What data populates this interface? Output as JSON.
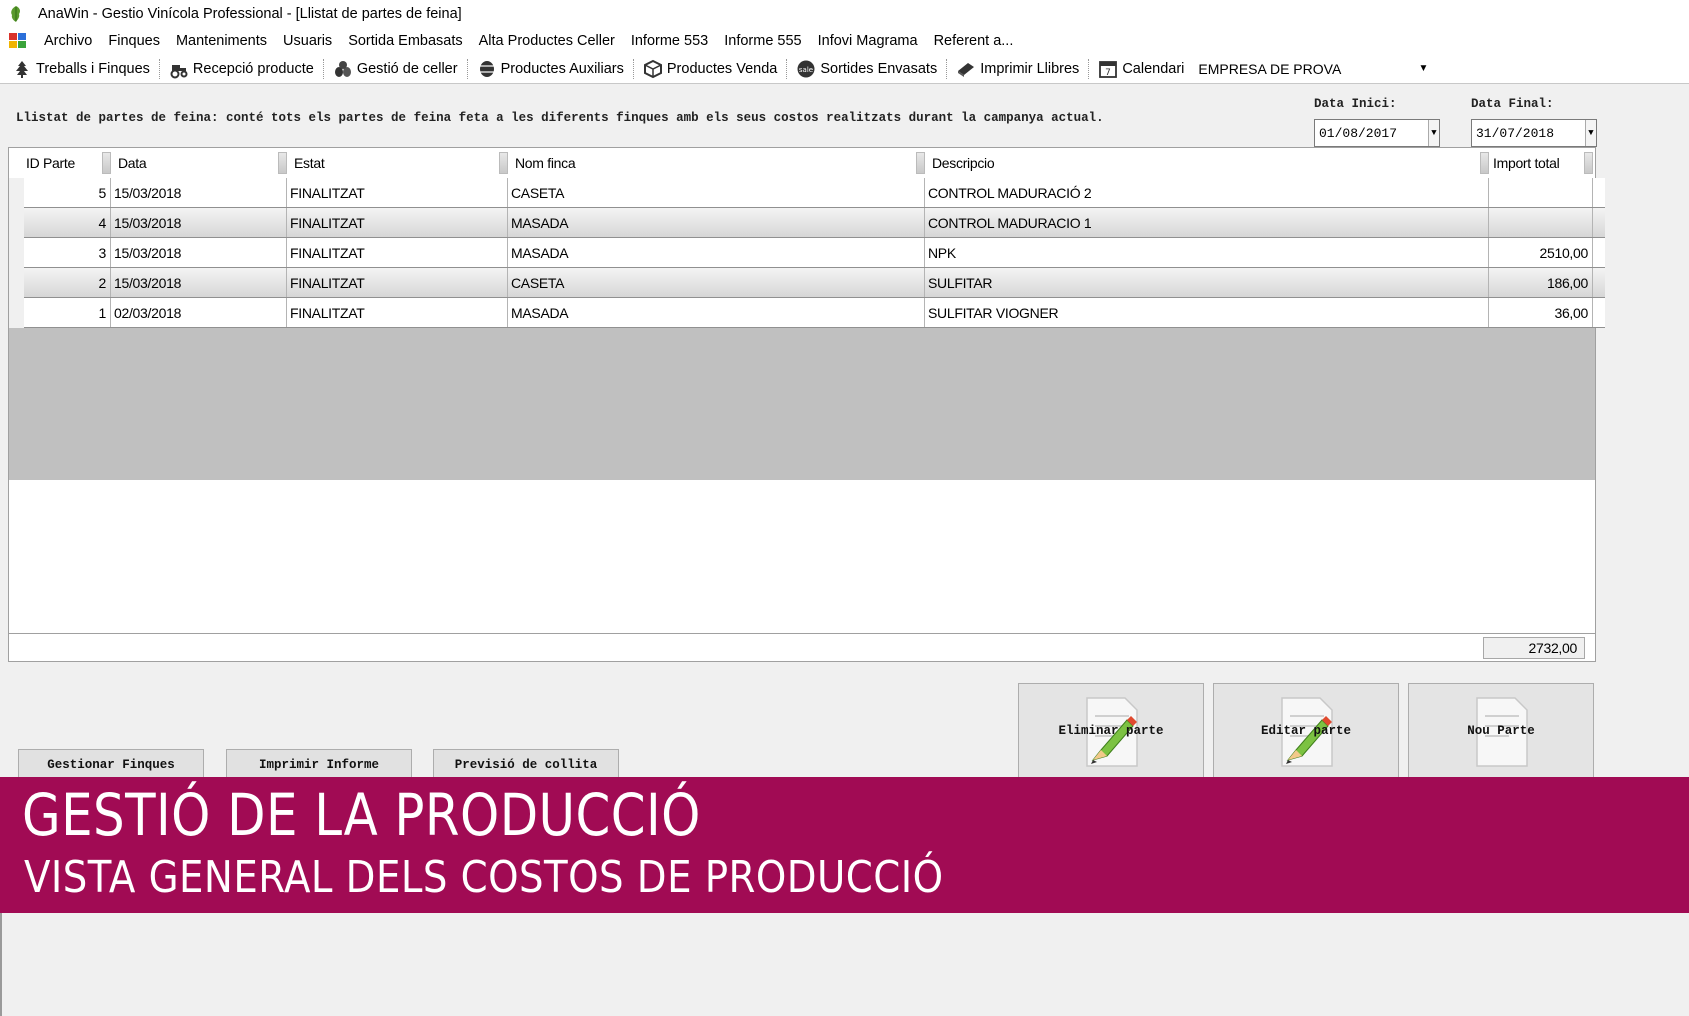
{
  "window": {
    "title": "AnaWin - Gestio Vinícola Professional - [Llistat de partes de feina]"
  },
  "menu": {
    "items": [
      {
        "label": "Archivo"
      },
      {
        "label": "Finques"
      },
      {
        "label": "Manteniments"
      },
      {
        "label": "Usuaris"
      },
      {
        "label": "Sortida Embasats"
      },
      {
        "label": "Alta Productes Celler"
      },
      {
        "label": "Informe 553"
      },
      {
        "label": "Informe 555"
      },
      {
        "label": "Infovi Magrama"
      },
      {
        "label": "Referent a..."
      }
    ]
  },
  "toolbar": {
    "items": [
      {
        "label": "Treballs i Finques",
        "icon": "tree-icon"
      },
      {
        "label": "Recepció producte",
        "icon": "tractor-icon"
      },
      {
        "label": "Gestió de celler",
        "icon": "barrels-icon"
      },
      {
        "label": "Productes Auxiliars",
        "icon": "barrel-icon"
      },
      {
        "label": "Productes Venda",
        "icon": "box-icon"
      },
      {
        "label": "Sortides Envasats",
        "icon": "sale-icon"
      },
      {
        "label": "Imprimir Llibres",
        "icon": "book-icon"
      },
      {
        "label": "Calendari",
        "icon": "calendar-icon"
      }
    ],
    "company": "EMPRESA DE PROVA"
  },
  "filters": {
    "description": "Llistat de partes de feina: conté tots els partes de feina feta a les diferents finques amb els seus costos realitzats durant la campanya actual.",
    "start_label": "Data Inici:",
    "start_value": "01/08/2017",
    "end_label": "Data Final:",
    "end_value": "31/07/2018"
  },
  "grid": {
    "columns": [
      "ID Parte",
      "Data",
      "Estat",
      "Nom finca",
      "Descripcio",
      "Import total"
    ],
    "rows": [
      {
        "id": "5",
        "date": "15/03/2018",
        "status": "FINALITZAT",
        "farm": "CASETA",
        "desc": "CONTROL MADURACIÓ 2",
        "total": ""
      },
      {
        "id": "4",
        "date": "15/03/2018",
        "status": "FINALITZAT",
        "farm": "MASADA",
        "desc": "CONTROL MADURACIO 1",
        "total": ""
      },
      {
        "id": "3",
        "date": "15/03/2018",
        "status": "FINALITZAT",
        "farm": "MASADA",
        "desc": "NPK",
        "total": "2510,00"
      },
      {
        "id": "2",
        "date": "15/03/2018",
        "status": "FINALITZAT",
        "farm": "CASETA",
        "desc": "SULFITAR",
        "total": "186,00"
      },
      {
        "id": "1",
        "date": "02/03/2018",
        "status": "FINALITZAT",
        "farm": "MASADA",
        "desc": "SULFITAR VIOGNER",
        "total": "36,00"
      }
    ],
    "sum_total": "2732,00"
  },
  "actions": {
    "delete": "Eliminar parte",
    "edit": "Editar parte",
    "new": "Nou Parte"
  },
  "bottom_buttons": {
    "farms": "Gestionar Finques",
    "print": "Imprimir Informe",
    "forecast": "Previsió de collita"
  },
  "banner": {
    "title": "GESTIÓ DE LA PRODUCCIÓ",
    "subtitle": "VISTA GENERAL DELS COSTOS DE PRODUCCIÓ"
  },
  "colors": {
    "banner": "#a10b54",
    "grid_empty": "#c0c0c0",
    "window_bg": "#f0f0f0"
  }
}
